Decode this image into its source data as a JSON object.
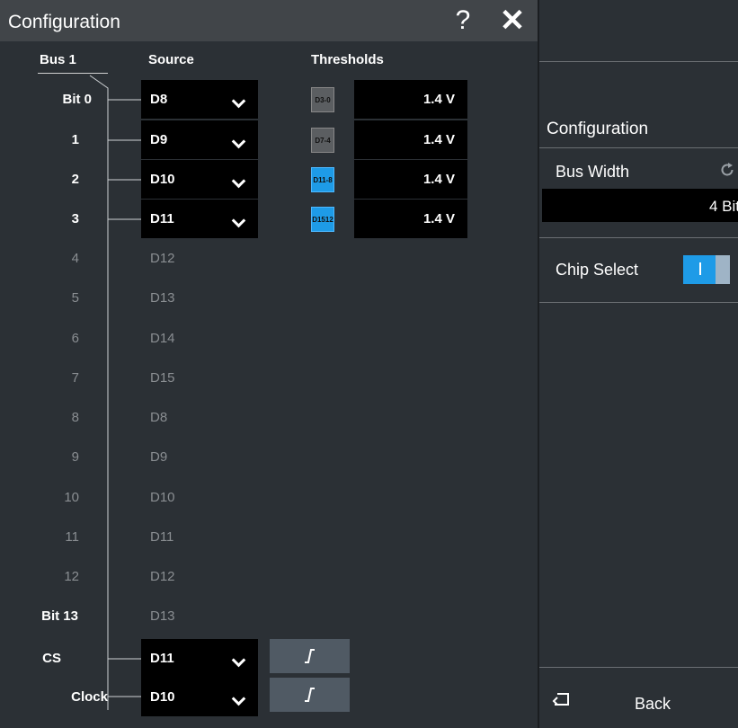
{
  "dialog": {
    "title": "Configuration",
    "help_icon": "question-mark-icon",
    "close_icon": "close-icon",
    "headers": {
      "bus": "Bus 1",
      "source": "Source",
      "thresholds": "Thresholds"
    },
    "active_bits": [
      {
        "label": "Bit 0",
        "source": "D8",
        "threshold_group": "D3-0",
        "threshold_group_color": "#5b5e61",
        "threshold_value": "1.4 V"
      },
      {
        "label": "1",
        "source": "D9",
        "threshold_group": "D7-4",
        "threshold_group_color": "#5b5e61",
        "threshold_value": "1.4 V"
      },
      {
        "label": "2",
        "source": "D10",
        "threshold_group": "D11-8",
        "threshold_group_color": "#1e9be7",
        "threshold_value": "1.4 V"
      },
      {
        "label": "3",
        "source": "D11",
        "threshold_group": "D1512",
        "threshold_group_color": "#1e9be7",
        "threshold_value": "1.4 V"
      }
    ],
    "inactive_bits": [
      {
        "label": "4",
        "source": "D12"
      },
      {
        "label": "5",
        "source": "D13"
      },
      {
        "label": "6",
        "source": "D14"
      },
      {
        "label": "7",
        "source": "D15"
      },
      {
        "label": "8",
        "source": "D8"
      },
      {
        "label": "9",
        "source": "D9"
      },
      {
        "label": "10",
        "source": "D10"
      },
      {
        "label": "11",
        "source": "D11"
      },
      {
        "label": "12",
        "source": "D12"
      },
      {
        "label": "Bit 13",
        "source": "D13"
      }
    ],
    "cs": {
      "label": "CS",
      "source": "D11",
      "edge_icon": "rising-edge-icon"
    },
    "clock": {
      "label": "Clock",
      "source": "D10",
      "edge_icon": "rising-edge-icon"
    },
    "chevron_icon": "chevron-down-icon"
  },
  "panel": {
    "title": "Configuration",
    "bus_width": {
      "label": "Bus Width",
      "value": "4 Bit",
      "reset_icon": "reset-icon"
    },
    "chip_select": {
      "label": "Chip Select",
      "enabled": true
    },
    "back": {
      "label": "Back",
      "icon": "back-arrow-icon"
    }
  },
  "colors": {
    "accent": "#1e9be7",
    "background": "#2b3035",
    "title_bar": "#414549"
  }
}
